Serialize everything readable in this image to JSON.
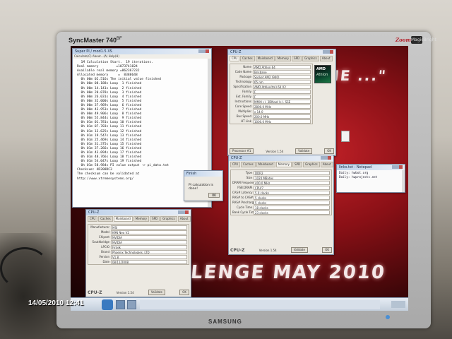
{
  "photo": {
    "timestamp": "14/05/2010 12:41"
  },
  "monitor": {
    "model_label": "SyncMaster 740",
    "model_suffix": "BF",
    "maker_logo": "SAMSUNG",
    "badge": "MagicBright",
    "corner_mark": "ZoomTek"
  },
  "wallpaper": {
    "text_top": "ME ...\"",
    "text_bottom": "LENGE MAY 2010"
  },
  "superpi": {
    "title": "Super PI / mod1.5 XS",
    "menu": "Calculate(C)  About...(A)  Help(H)",
    "lines": [
      "  1M Calculation Start.  19 iterations.",
      "Real memory         =1073741824",
      "Available real memory =862367232",
      "Allocated memory     =  8388648",
      "  0h 00m 02.516s The initial value finished",
      "  0h 00m 08.188s Loop  1 finished",
      "  0h 00m 14.141s Loop  2 finished",
      "  0h 00m 20.078s Loop  3 finished",
      "  0h 00m 26.031s Loop  4 finished",
      "  0h 00m 32.000s Loop  5 finished",
      "  0h 00m 37.969s Loop  6 finished",
      "  0h 00m 43.953s Loop  7 finished",
      "  0h 00m 49.906s Loop  8 finished",
      "  0h 00m 55.844s Loop  9 finished",
      "  0h 01m 01.781s Loop 10 finished",
      "  0h 01m 07.703s Loop 11 finished",
      "  0h 01m 13.625s Loop 12 finished",
      "  0h 01m 19.547s Loop 13 finished",
      "  0h 01m 25.469s Loop 14 finished",
      "  0h 01m 31.375s Loop 15 finished",
      "  0h 01m 37.266s Loop 16 finished",
      "  0h 01m 43.094s Loop 17 finished",
      "  0h 01m 48.766s Loop 18 finished",
      "  0h 01m 54.047s Loop 19 finished",
      "  0h 01m 58.984s PI value output -> pi_data.txt",
      "",
      "Checksum: 4D208DC3",
      "The checksum can be validated at",
      "http://www.xtremesystems.org/"
    ]
  },
  "finish_dialog": {
    "title": "Finish",
    "message": "PI calculation is done!",
    "ok": "OK"
  },
  "cpuz_cpu": {
    "title": "CPU-Z",
    "tabs": [
      "CPU",
      "Caches",
      "Mainboard",
      "Memory",
      "SPD",
      "Graphics",
      "About"
    ],
    "active_tab": "CPU",
    "rows": [
      {
        "label": "Name",
        "value": "AMD Athlon 64"
      },
      {
        "label": "Code Name",
        "value": "Brisbane"
      },
      {
        "label": "Package",
        "value": "Socket AM2 (940)"
      },
      {
        "label": "Technology",
        "value": "65 nm"
      },
      {
        "label": "Specification",
        "value": "AMD Athlon(tm) 64 X2"
      },
      {
        "label": "Family",
        "value": "F"
      },
      {
        "label": "Ext. Family",
        "value": "F"
      },
      {
        "label": "Instructions",
        "value": "MMX(+), 3DNow!(+), SSE"
      },
      {
        "label": "Core Speed",
        "value": "2800.0 MHz"
      },
      {
        "label": "Multiplier",
        "value": "x 14.0"
      },
      {
        "label": "Bus Speed",
        "value": "200.0 MHz"
      },
      {
        "label": "HT Link",
        "value": "1000.0 MHz"
      }
    ],
    "logo_brand": "AMD",
    "logo_product": "Athlon",
    "selection": "Processor #1",
    "version": "Version 1.54",
    "validate": "Validate",
    "ok": "OK"
  },
  "cpuz_memory": {
    "title": "CPU-Z",
    "tabs": [
      "CPU",
      "Caches",
      "Mainboard",
      "Memory",
      "SPD",
      "Graphics",
      "About"
    ],
    "active_tab": "Memory",
    "rows": [
      {
        "label": "Type",
        "value": "DDR2"
      },
      {
        "label": "Size",
        "value": "1024 MBytes"
      },
      {
        "label": "DRAM Frequency",
        "value": "400.0 MHz"
      },
      {
        "label": "FSB:DRAM",
        "value": "CPU/7"
      },
      {
        "label": "CAS# Latency",
        "value": "5.0 clocks"
      },
      {
        "label": "RAS# to CAS#",
        "value": "5 clocks"
      },
      {
        "label": "RAS# Precharge",
        "value": "5 clocks"
      },
      {
        "label": "Cycle Time",
        "value": "18 clocks"
      },
      {
        "label": "Bank Cycle Time",
        "value": "23 clocks"
      }
    ],
    "version": "Version 1.54",
    "validate": "Validate",
    "ok": "OK"
  },
  "cpuz_mainboard": {
    "title": "CPU-Z",
    "tabs": [
      "CPU",
      "Caches",
      "Mainboard",
      "Memory",
      "SPD",
      "Graphics",
      "About"
    ],
    "active_tab": "Mainboard",
    "rows": [
      {
        "label": "Manufacturer",
        "value": "MSI"
      },
      {
        "label": "Model",
        "value": "K9N Neo V2"
      },
      {
        "label": "Chipset",
        "value": "NVIDIA"
      },
      {
        "label": "Southbridge",
        "value": "NVIDIA"
      },
      {
        "label": "LPCIO",
        "value": "Fintek"
      },
      {
        "label": "Brand",
        "value": "Phoenix Technologies, LTD"
      },
      {
        "label": "Version",
        "value": "V1.8"
      },
      {
        "label": "Date",
        "value": "08/11/2008"
      }
    ],
    "version": "Version 1.54",
    "validate": "Validate",
    "ok": "OK"
  },
  "textwin": {
    "title": "links.txt - Notepad",
    "lines": [
      "Daily: hwbot.org",
      "Daily: hwprojects.net"
    ]
  }
}
